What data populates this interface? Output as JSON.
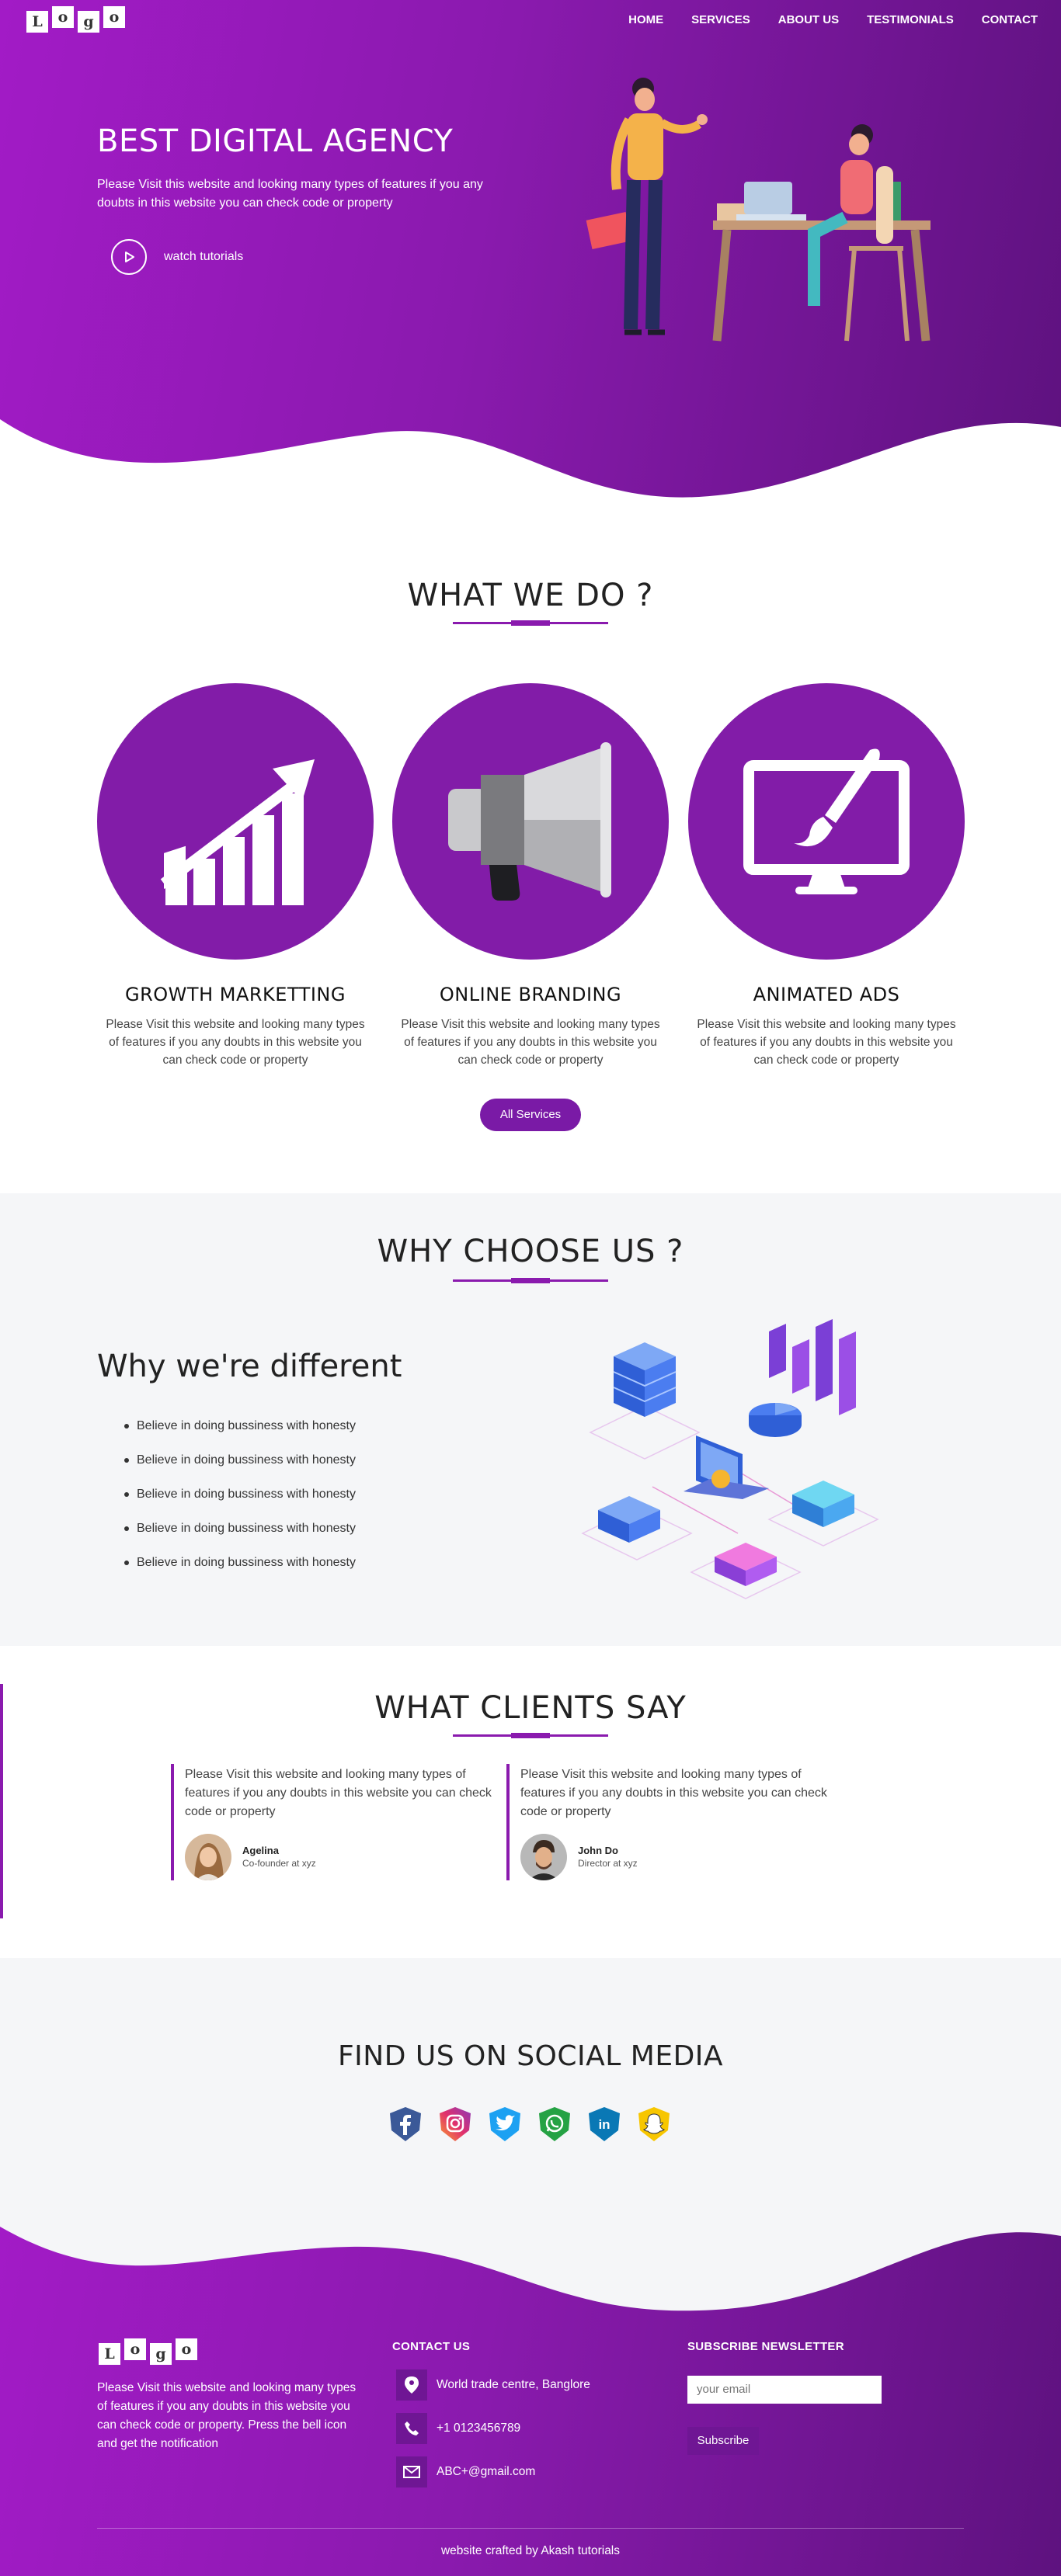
{
  "header": {
    "logo_letters": [
      "L",
      "o",
      "g",
      "o"
    ],
    "nav": [
      "HOME",
      "SERVICES",
      "ABOUT US",
      "TESTIMONIALS",
      "CONTACT"
    ]
  },
  "hero": {
    "title": "BEST DIGITAL AGENCY",
    "text": "Please Visit this website and looking many types of features if you any doubts in this website you can check code or property",
    "watch_label": "watch tutorials",
    "illustration": "two-people-office-illustration"
  },
  "services": {
    "title": "WHAT WE DO ?",
    "items": [
      {
        "name": "GROWTH MARKETTING",
        "icon": "growth-chart-icon",
        "text": "Please Visit this website and looking many types of features if you any doubts in this website you can check code or property"
      },
      {
        "name": "ONLINE BRANDING",
        "icon": "megaphone-icon",
        "text": "Please Visit this website and looking many types of features if you any doubts in this website you can check code or property"
      },
      {
        "name": "ANIMATED ADS",
        "icon": "monitor-brush-icon",
        "text": "Please Visit this website and looking many types of features if you any doubts in this website you can check code or property"
      }
    ],
    "button": "All Services"
  },
  "why": {
    "title": "WHY CHOOSE US ?",
    "heading": "Why we're different",
    "points": [
      "Believe in doing bussiness with honesty",
      "Believe in doing bussiness with honesty",
      "Believe in doing bussiness with honesty",
      "Believe in doing bussiness with honesty",
      "Believe in doing bussiness with honesty"
    ],
    "illustration": "isometric-servers-illustration"
  },
  "clients": {
    "title": "WHAT CLIENTS SAY",
    "items": [
      {
        "text": "Please Visit this website and looking many types of features if you any doubts in this website you can check code or property",
        "name": "Agelina",
        "role": "Co-founder at xyz"
      },
      {
        "text": "Please Visit this website and looking many types of features if you any doubts in this website you can check code or property",
        "name": "John Do",
        "role": "Director at xyz"
      }
    ]
  },
  "social": {
    "title": "FIND US ON SOCIAL MEDIA",
    "icons": [
      "facebook-icon",
      "instagram-icon",
      "twitter-icon",
      "whatsapp-icon",
      "linkedin-icon",
      "snapchat-icon"
    ]
  },
  "footer": {
    "text": "Please Visit this website and looking many types of features if you any doubts in this website you can check code or property. Press the bell icon and get the notification",
    "contact_title": "CONTACT US",
    "address": "World trade centre, Banglore",
    "phone": "+1 0123456789",
    "email": "ABC+@gmail.com",
    "newsletter_title": "SUBSCRIBE NEWSLETTER",
    "email_placeholder": "your email",
    "subscribe": "Subscribe",
    "credit": "website crafted by Akash tutorials"
  },
  "colors": {
    "primary": "#8a1aae",
    "gradient_start": "#a21bc6",
    "gradient_end": "#5e127f",
    "section_bg": "#f5f6f8"
  }
}
